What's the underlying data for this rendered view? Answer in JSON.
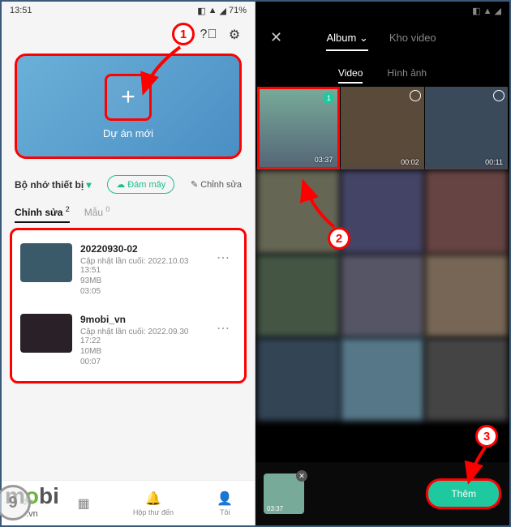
{
  "left": {
    "status": {
      "time": "13:51",
      "battery": "71%"
    },
    "hero": {
      "plus": "+",
      "label": "Dự án mới"
    },
    "storage": {
      "label": "Bộ nhớ thiết bị",
      "cloud": "Đám mây",
      "edit": "Chỉnh sửa"
    },
    "tabs": {
      "edit": "Chỉnh sửa",
      "edit_count": "2",
      "template": "Mẫu",
      "template_count": "0"
    },
    "projects": [
      {
        "title": "20220930-02",
        "updated": "Cập nhật lần cuối: 2022.10.03 13:51",
        "size": "93MB",
        "duration": "03:05"
      },
      {
        "title": "9mobi_vn",
        "updated": "Cập nhật lần cuối: 2022.09.30 17:22",
        "size": "10MB",
        "duration": "00:07"
      }
    ],
    "nav": {
      "inbox": "Hộp thư đến",
      "me": "Tôi"
    }
  },
  "right": {
    "header": {
      "album": "Album",
      "dropdown": "⌄",
      "repo": "Kho video"
    },
    "subtabs": {
      "video": "Video",
      "image": "Hình ảnh"
    },
    "items": [
      {
        "dur": "03:37",
        "selected": true,
        "badge": "1"
      },
      {
        "dur": "00:02"
      },
      {
        "dur": "00:11"
      }
    ],
    "strip": {
      "dur": "03:37"
    },
    "add": "Thêm"
  },
  "callouts": {
    "c1": "1",
    "c2": "2",
    "c3": "3"
  },
  "watermark": {
    "text1": "m",
    "o": "o",
    "text2": "bi",
    "sub": ".vn",
    "nine": "9"
  }
}
